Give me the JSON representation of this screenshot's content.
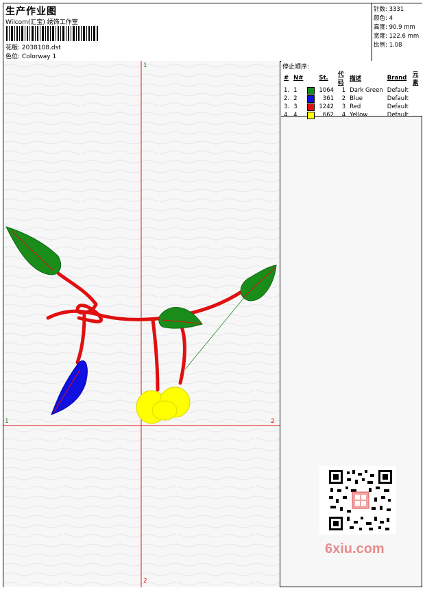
{
  "header": {
    "title": "生产作业图",
    "company": "Wilcom(汇宝) 绣饰工作室",
    "design_label": "花版:",
    "design_value": "2038108.dst",
    "colorway_label": "色位:",
    "colorway_value": "Colorway 1"
  },
  "stats": {
    "stitches": "针数: 3331",
    "colors": "颜色: 4",
    "height": "高度: 90.9 mm",
    "width": "宽度: 122.6 mm",
    "scale": "比例: 1.08"
  },
  "threads": {
    "title": "停止顺序:",
    "headers": [
      "#",
      "N#",
      "St.",
      "代码",
      "描述",
      "Brand",
      "元素"
    ],
    "rows": [
      {
        "idx": "1.",
        "n": "1",
        "color": "#1a8c1a",
        "st": "1064",
        "code": "1",
        "desc": "Dark Green",
        "brand": "Default"
      },
      {
        "idx": "2.",
        "n": "2",
        "color": "#1010e0",
        "st": "361",
        "code": "2",
        "desc": "Blue",
        "brand": "Default"
      },
      {
        "idx": "3.",
        "n": "3",
        "color": "#e01010",
        "st": "1242",
        "code": "3",
        "desc": "Red",
        "brand": "Default"
      },
      {
        "idx": "4.",
        "n": "4",
        "color": "#ffff00",
        "st": "662",
        "code": "4",
        "desc": "Yellow",
        "brand": "Default"
      }
    ]
  },
  "axes": {
    "top": "1",
    "bottom": "2",
    "left": "1",
    "right": "2"
  },
  "watermark": "6xiu.com",
  "colors": {
    "axis": "#e01010",
    "leaf": "#1a8c1a",
    "stem": "#e01010",
    "blue_leaf": "#1010e0",
    "fruit": "#ffff00"
  }
}
